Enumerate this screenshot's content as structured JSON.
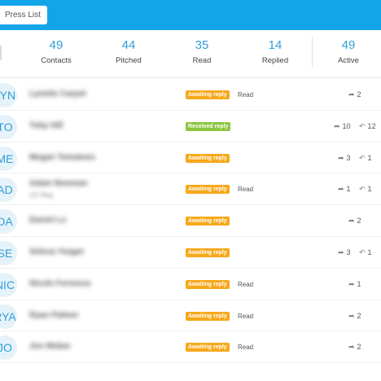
{
  "toolbar": {
    "press_list_label": "Press List"
  },
  "stats": [
    {
      "value": "49",
      "label": "Contacts"
    },
    {
      "value": "44",
      "label": "Pitched"
    },
    {
      "value": "35",
      "label": "Read"
    },
    {
      "value": "14",
      "label": "Replied"
    },
    {
      "value": "49",
      "label": "Active"
    }
  ],
  "icons": {
    "sent": "paper-plane-icon",
    "reply": "reply-arrow-icon"
  },
  "colors": {
    "topbar": "#12a5ea",
    "awaiting": "#f7a81b",
    "received": "#8cc63f",
    "accent": "#2f9fd8"
  },
  "rows": [
    {
      "initials": "LYN",
      "name": "Lynette Carpet",
      "sub": "",
      "status": "Awaiting reply",
      "read": "Read",
      "sent": "2",
      "replies": ""
    },
    {
      "initials": "TO",
      "name": "Toby Hill",
      "sub": "",
      "status": "Received reply",
      "read": "",
      "sent": "10",
      "replies": "12"
    },
    {
      "initials": "ME",
      "name": "Megan Tomatoes",
      "sub": "",
      "status": "Awaiting reply",
      "read": "",
      "sent": "3",
      "replies": "1"
    },
    {
      "initials": "AD",
      "name": "Adam Newman",
      "sub": "UX Mag",
      "status": "Awaiting reply",
      "read": "Read",
      "sent": "1",
      "replies": "1"
    },
    {
      "initials": "DA",
      "name": "Daniel Lu",
      "sub": "",
      "status": "Awaiting reply",
      "read": "",
      "sent": "2",
      "replies": ""
    },
    {
      "initials": "SE",
      "name": "Selena Yeager",
      "sub": "",
      "status": "Awaiting reply",
      "read": "",
      "sent": "3",
      "replies": "1"
    },
    {
      "initials": "NIC",
      "name": "Nicole Formosa",
      "sub": "",
      "status": "Awaiting reply",
      "read": "Read",
      "sent": "1",
      "replies": ""
    },
    {
      "initials": "RYA",
      "name": "Ryan Palmer",
      "sub": "",
      "status": "Awaiting reply",
      "read": "Read",
      "sent": "2",
      "replies": ""
    },
    {
      "initials": "JO",
      "name": "Jon Weber",
      "sub": "",
      "status": "Awaiting reply",
      "read": "Read",
      "sent": "2",
      "replies": ""
    }
  ]
}
